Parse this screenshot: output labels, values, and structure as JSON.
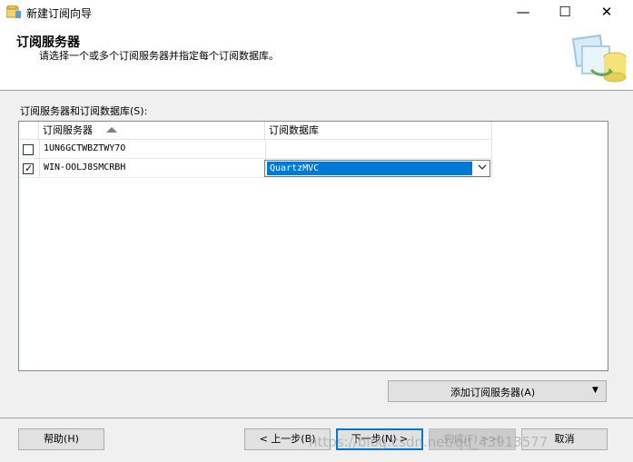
{
  "window": {
    "title": "新建订阅向导",
    "controls": {
      "minimize": "—",
      "maximize": "☐",
      "close": "✕"
    }
  },
  "header": {
    "title": "订阅服务器",
    "subtitle": "请选择一个或多个订阅服务器并指定每个订阅数据库。"
  },
  "grid": {
    "label": "订阅服务器和订阅数据库(S):",
    "columns": [
      "订阅服务器",
      "订阅数据库"
    ],
    "rows": [
      {
        "checked": false,
        "server": "1UN6GCTWBZTWY7O",
        "database": ""
      },
      {
        "checked": true,
        "server": "WIN-OOLJ8SMCRBH",
        "database": "QuartzMVC"
      }
    ]
  },
  "add_button": {
    "label": "添加订阅服务器(A)",
    "arrow": "▼"
  },
  "footer": {
    "help": "帮助(H)",
    "back": "< 上一步(B)",
    "next": "下一步(N) >",
    "finish": "完成(F) >>|",
    "cancel": "取消"
  },
  "watermark": "https://blog.csdn.net/qq_43913577",
  "colors": {
    "selection": "#0078d7",
    "dialog_bg": "#f0f0f0"
  }
}
